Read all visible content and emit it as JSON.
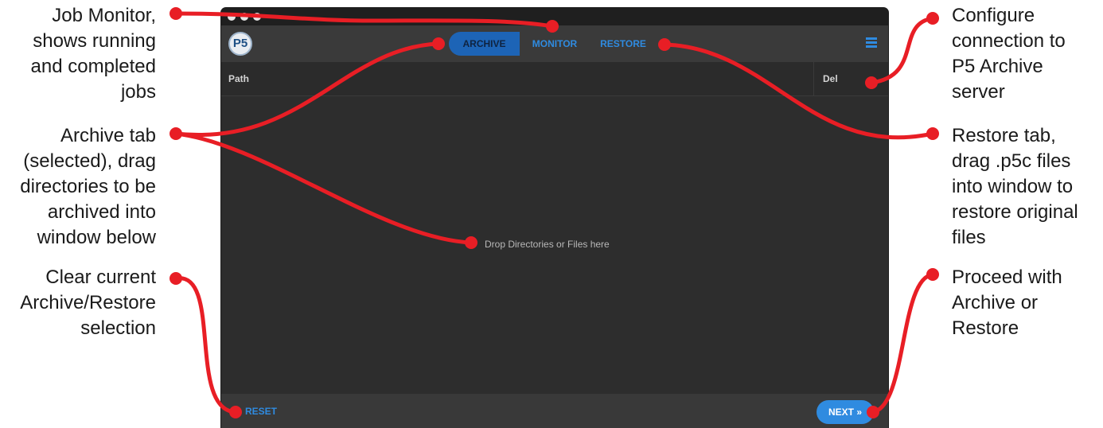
{
  "callouts": {
    "job_monitor": [
      "Job Monitor,",
      "shows running",
      "and completed",
      "jobs"
    ],
    "archive_tab": [
      "Archive tab",
      "(selected), drag",
      "directories to be",
      "archived into",
      "window below"
    ],
    "clear": [
      "Clear current",
      "Archive/Restore",
      "selection"
    ],
    "configure": [
      "Configure",
      "connection to",
      "P5 Archive",
      "server"
    ],
    "restore_tab": [
      "Restore tab,",
      "drag .p5c files",
      "into window to",
      "restore original",
      "files"
    ],
    "proceed": [
      "Proceed with",
      "Archive or",
      "Restore"
    ]
  },
  "app": {
    "logo": "P5",
    "tabs": {
      "archive": "ARCHIVE",
      "monitor": "MONITOR",
      "restore": "RESTORE"
    },
    "menu_icon": "hamburger-menu-icon",
    "table": {
      "path_header": "Path",
      "del_header": "Del"
    },
    "drop_text": "Drop Directories or Files here",
    "footer": {
      "reset": "RESET",
      "next": "NEXT »"
    }
  },
  "colors": {
    "callout_line": "#e81e25",
    "accent": "#2f8be0",
    "selected_tab": "#1d64b6"
  }
}
